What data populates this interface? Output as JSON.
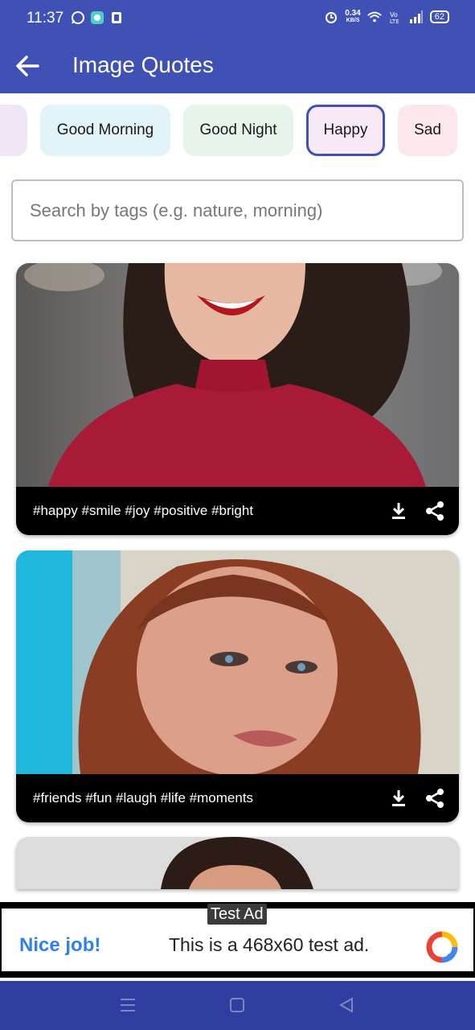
{
  "status_bar": {
    "time": "11:37",
    "net_speed_value": "0.34",
    "net_speed_unit": "KB/S",
    "battery": "62"
  },
  "app_bar": {
    "title": "Image Quotes"
  },
  "chips": [
    {
      "label": "",
      "bg": "#efe7f6"
    },
    {
      "label": "Good Morning",
      "bg": "#e2f4f8"
    },
    {
      "label": "Good Night",
      "bg": "#e6f4e9"
    },
    {
      "label": "Happy",
      "bg": "#f7e9f5",
      "selected": true
    },
    {
      "label": "Sad",
      "bg": "#fbe7ec"
    }
  ],
  "search": {
    "placeholder": "Search by tags (e.g. nature, morning)",
    "value": ""
  },
  "cards": [
    {
      "tags": "#happy #smile #joy #positive #bright"
    },
    {
      "tags": "#friends #fun #laugh #life #moments"
    },
    {
      "tags": ""
    }
  ],
  "ad": {
    "label": "Test Ad",
    "headline": "Nice job!",
    "text": "This is a 468x60 test ad."
  },
  "colors": {
    "primary": "#3f51b5",
    "nav_bar": "#303f9f",
    "selected_chip_border": "#3f51b5"
  },
  "icons": {
    "back": "arrow-left-icon",
    "download": "download-icon",
    "share": "share-icon"
  }
}
